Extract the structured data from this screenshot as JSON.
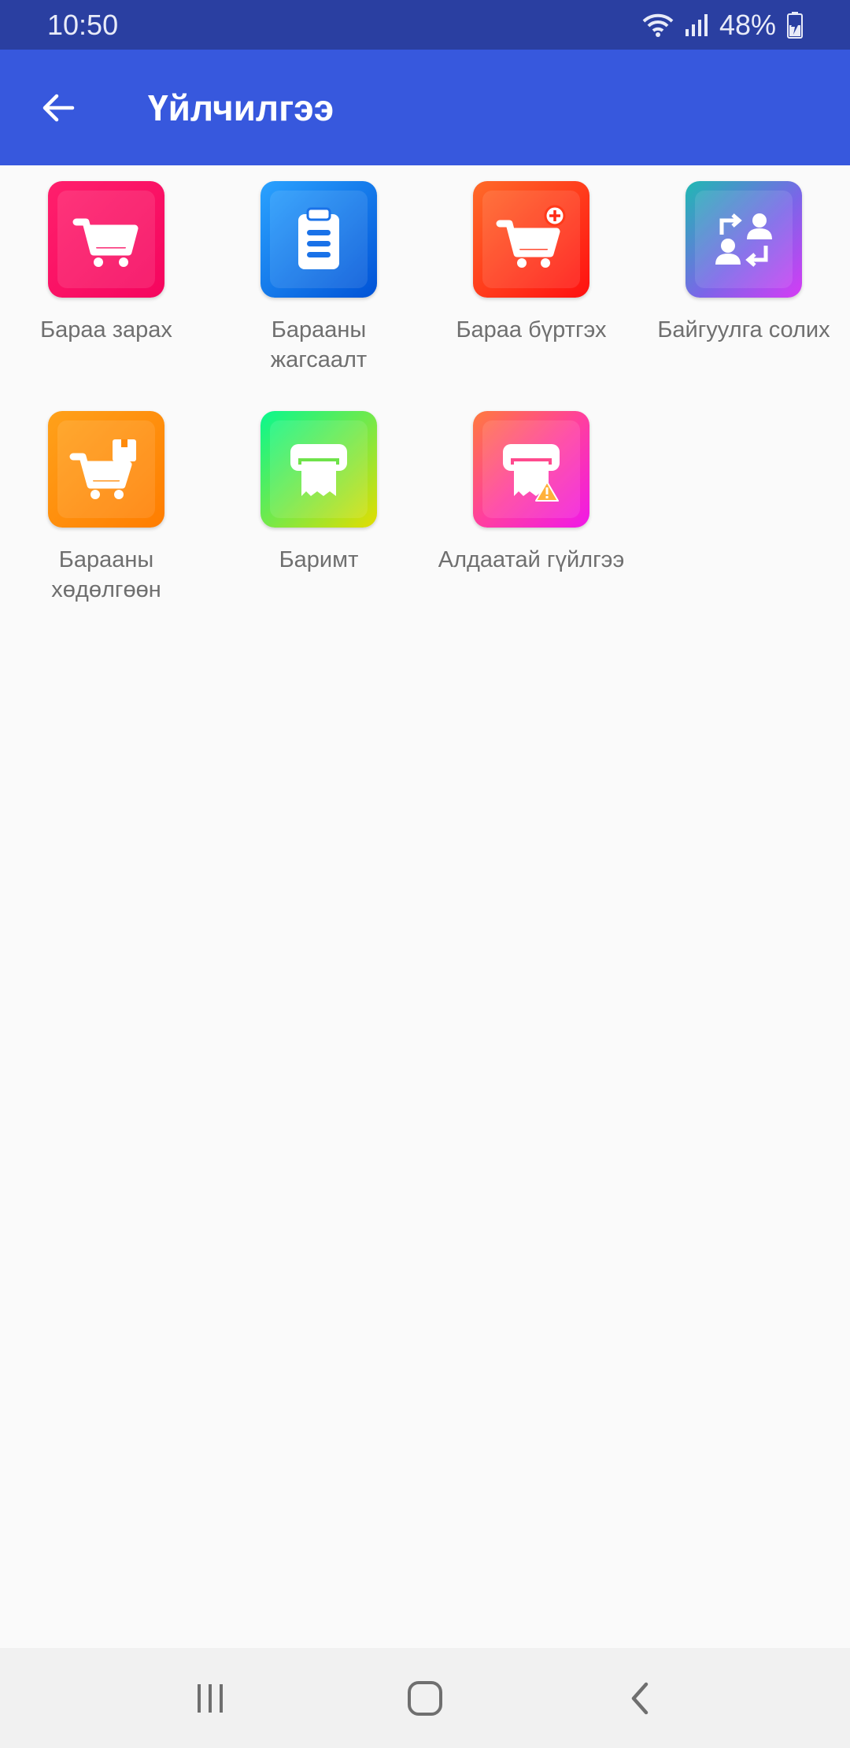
{
  "status_bar": {
    "time": "10:50",
    "battery": "48%"
  },
  "app_bar": {
    "title": "Үйлчилгээ"
  },
  "tiles": [
    {
      "label": "Бараа зарах",
      "icon": "shopping-cart-icon",
      "color": "#f5055e"
    },
    {
      "label": "Барааны\nжагсаалт",
      "icon": "clipboard-list-icon",
      "color": "#0052d6"
    },
    {
      "label": "Бараа бүртгэх",
      "icon": "cart-add-icon",
      "color": "#ff1010"
    },
    {
      "label": "Байгуулга солих",
      "icon": "switch-users-icon",
      "color": "#7a66e8"
    },
    {
      "label": "Барааны\nхөдөлгөөн",
      "icon": "cart-box-icon",
      "color": "#ff7d00"
    },
    {
      "label": "Баримт",
      "icon": "receipt-printer-icon",
      "color": "#72e94b"
    },
    {
      "label": "Алдаатай гүйлгээ",
      "icon": "receipt-warning-icon",
      "color": "#ff3f9e"
    }
  ],
  "colors": {
    "status_bar": "#2a3fa1",
    "app_bar": "#3758dd",
    "background": "#fafafa",
    "label_text": "#6f6f6f"
  }
}
